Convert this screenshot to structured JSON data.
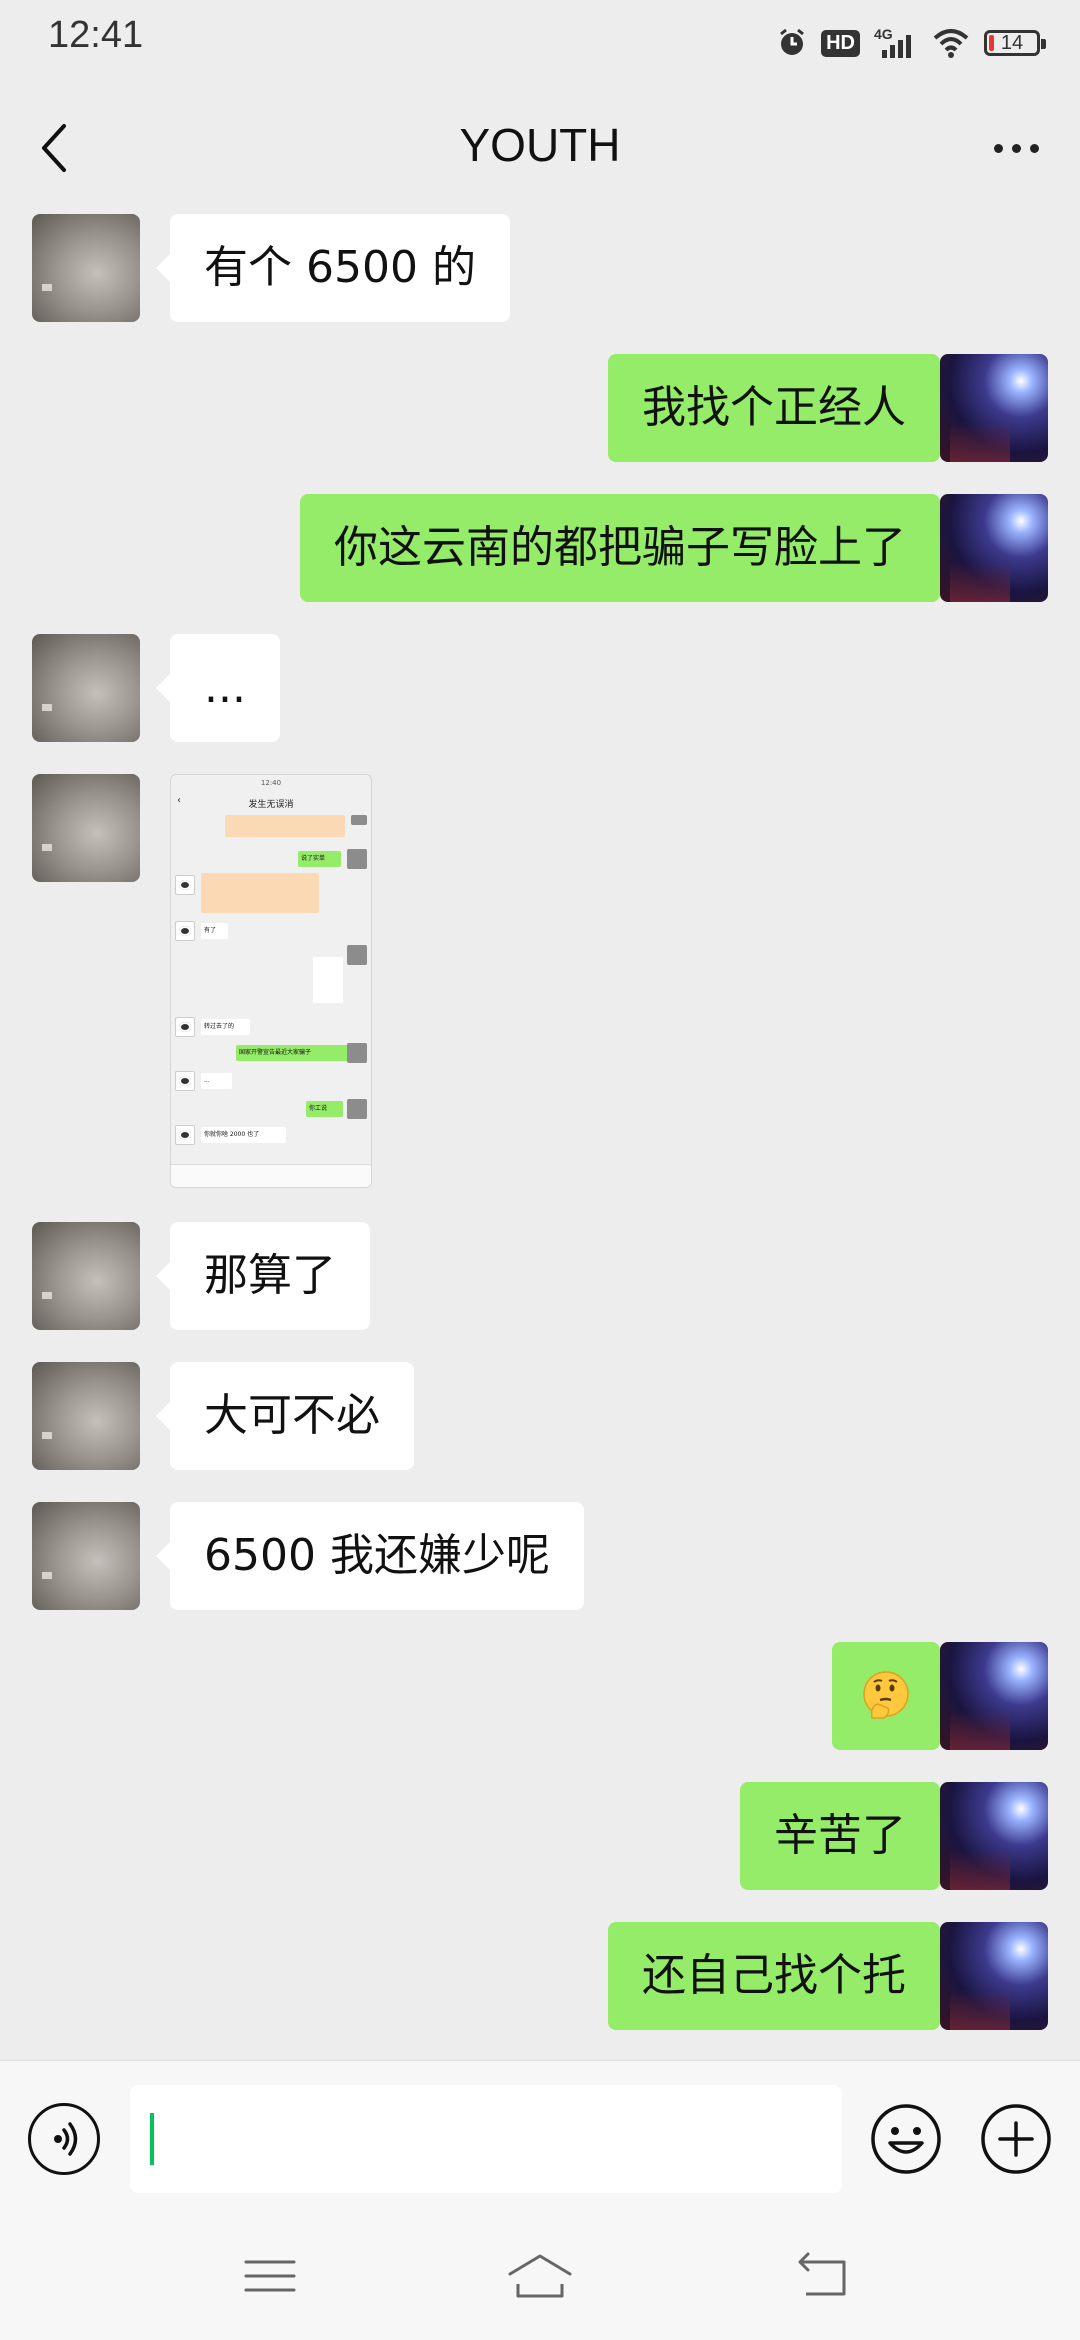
{
  "status_bar": {
    "time": "12:41",
    "network": "4G",
    "hd_badge": "HD",
    "battery_level": "14",
    "icons": [
      "alarm-icon",
      "hd-icon",
      "signal-icon",
      "wifi-icon",
      "battery-icon"
    ]
  },
  "nav": {
    "title": "YOUTH",
    "back_icon": "chevron-left-icon",
    "more_icon": "more-dots-icon"
  },
  "messages": [
    {
      "side": "left",
      "type": "text",
      "text": "有个 6500 的"
    },
    {
      "side": "right",
      "type": "text",
      "text": "我找个正经人"
    },
    {
      "side": "right",
      "type": "text",
      "text": "你这云南的都把骗子写脸上了"
    },
    {
      "side": "left",
      "type": "text",
      "text": "..."
    },
    {
      "side": "left",
      "type": "image",
      "text": "screenshot-thumbnail"
    },
    {
      "side": "left",
      "type": "text",
      "text": "那算了"
    },
    {
      "side": "left",
      "type": "text",
      "text": "大可不必"
    },
    {
      "side": "left",
      "type": "text",
      "text": "6500 我还嫌少呢"
    },
    {
      "side": "right",
      "type": "emoji",
      "text": "thinking-face-emoji"
    },
    {
      "side": "right",
      "type": "text",
      "text": "辛苦了"
    },
    {
      "side": "right",
      "type": "text",
      "text": "还自己找个托"
    }
  ],
  "thumbnail": {
    "status_time": "12:40",
    "title": "发生无误消",
    "green_text_1": "说了实单",
    "white_text_1": "有了",
    "white_text_2": "转过去了的",
    "green_text_2": "国家开警宣告最近大家骗子",
    "white_text_3": "...",
    "green_text_3": "你工说",
    "white_text_4": "你就你啥 2000 也了"
  },
  "input_bar": {
    "voice_icon": "voice-icon",
    "emoji_icon": "smiley-icon",
    "plus_icon": "plus-icon",
    "text_value": ""
  },
  "system_nav": {
    "menu_icon": "menu-icon",
    "home_icon": "home-icon",
    "back_icon": "back-icon"
  }
}
